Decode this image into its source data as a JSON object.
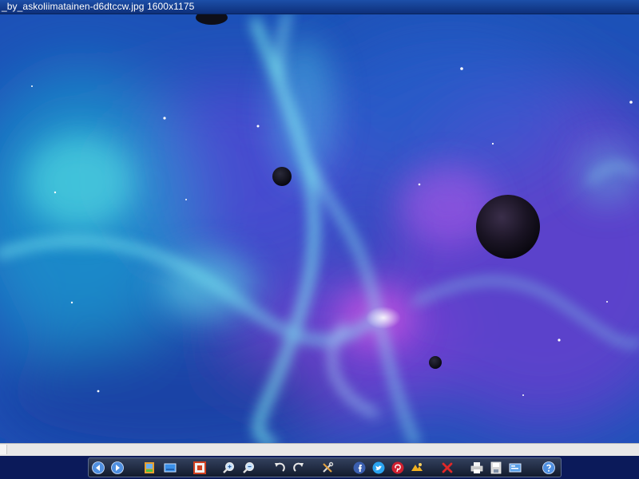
{
  "window": {
    "title": "_by_askoliimatainen-d6dtccw.jpg  1600x1175"
  },
  "colors": {
    "titlebar": "#1c4fa8",
    "toolbar": "#1f2a42",
    "scrollbar": "#e8e8e8"
  },
  "toolbar": {
    "buttons": [
      {
        "id": "previous",
        "icon": "arrow-left-icon"
      },
      {
        "id": "next",
        "icon": "arrow-right-icon"
      },
      {
        "id": "slideshow",
        "icon": "slideshow-icon"
      },
      {
        "id": "set-wallpaper",
        "icon": "wallpaper-icon"
      },
      {
        "id": "fit-to-window",
        "icon": "fit-window-icon"
      },
      {
        "id": "zoom-in",
        "icon": "zoom-in-icon"
      },
      {
        "id": "zoom-out",
        "icon": "zoom-out-icon"
      },
      {
        "id": "rotate-left",
        "icon": "rotate-left-icon"
      },
      {
        "id": "rotate-right",
        "icon": "rotate-right-icon"
      },
      {
        "id": "tools",
        "icon": "tools-icon"
      },
      {
        "id": "share-facebook",
        "icon": "facebook-icon"
      },
      {
        "id": "share-twitter",
        "icon": "twitter-icon"
      },
      {
        "id": "share-pinterest",
        "icon": "pinterest-icon"
      },
      {
        "id": "effects",
        "icon": "effects-icon"
      },
      {
        "id": "delete",
        "icon": "delete-icon"
      },
      {
        "id": "print",
        "icon": "print-icon"
      },
      {
        "id": "save",
        "icon": "save-icon"
      },
      {
        "id": "show-info",
        "icon": "info-panel-icon"
      },
      {
        "id": "help",
        "icon": "help-icon"
      }
    ]
  }
}
